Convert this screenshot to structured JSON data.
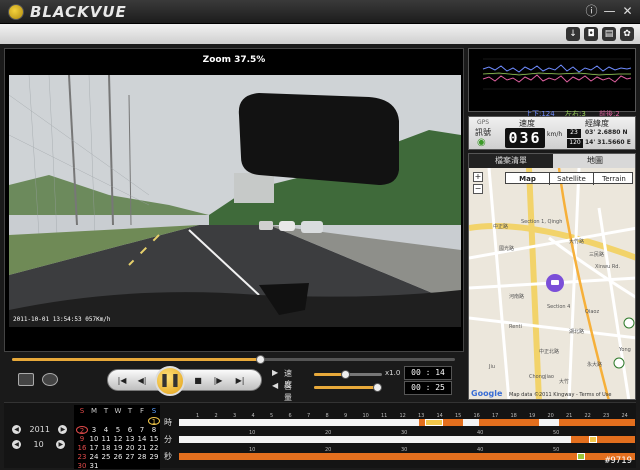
{
  "app": {
    "logo_text": "BLACKVUE"
  },
  "video": {
    "zoom_label": "Zoom 37.5%",
    "stamp": "2011-10-01 13:54:53 057Km/h"
  },
  "transport": {
    "speed_label": "速度",
    "speed_value": "x1.0",
    "volume_label": "音量",
    "current_time": "00 : 14",
    "total_time": "00 : 25",
    "seek_fraction": 0.56,
    "speed_fraction": 0.45,
    "volume_fraction": 0.92
  },
  "graph": {
    "up_down": "上下:124",
    "left_right": "左右:3",
    "front_back": "前後:2"
  },
  "gps": {
    "gps_label": "GPS",
    "signal_label": "訊號",
    "speed_title": "速度",
    "speed_value": "036",
    "speed_unit": "km/h",
    "coord_title": "經緯度",
    "lat_deg": "23",
    "lat_rest": "03' 2.6880 N",
    "lon_deg": "120",
    "lon_rest": "14' 31.5660 E"
  },
  "map": {
    "tab_file_list": "檔案清單",
    "tab_map": "地圖",
    "type_map": "Map",
    "type_satellite": "Satellite",
    "type_terrain": "Terrain",
    "copyright": "Map data ©2011 Kingway - Terms of Use",
    "google": "Google",
    "labels": [
      "Section 1, Qingh",
      "國光路",
      "Xinwu Rd.",
      "三民路",
      "河南路",
      "Section 4",
      "中正北路",
      "永大路",
      "Yong",
      "大竹路",
      "Qiaoz",
      "大竹",
      "Renti",
      "Jiu",
      "中正路",
      "湖北路",
      "Chongjiao"
    ]
  },
  "date": {
    "year": "2011",
    "month": "10"
  },
  "calendar": {
    "headers": [
      "S",
      "M",
      "T",
      "W",
      "T",
      "F",
      "S"
    ],
    "weeks": [
      [
        "",
        "",
        "",
        "",
        "",
        "",
        "1"
      ],
      [
        "2",
        "3",
        "4",
        "5",
        "6",
        "7",
        "8"
      ],
      [
        "9",
        "10",
        "11",
        "12",
        "13",
        "14",
        "15"
      ],
      [
        "16",
        "17",
        "18",
        "19",
        "20",
        "21",
        "22"
      ],
      [
        "23",
        "24",
        "25",
        "26",
        "27",
        "28",
        "29"
      ],
      [
        "30",
        "31",
        "",
        "",
        "",
        "",
        ""
      ]
    ],
    "selected_day": "1",
    "circled_day": "2"
  },
  "timeline": {
    "hour_label": "時",
    "minute_label": "分",
    "second_label": "秒",
    "hour_ticks": [
      "1",
      "2",
      "3",
      "4",
      "5",
      "6",
      "7",
      "8",
      "9",
      "10",
      "11",
      "12",
      "13",
      "14",
      "15",
      "16",
      "17",
      "18",
      "19",
      "20",
      "21",
      "22",
      "23",
      "24"
    ],
    "minute_ticks": [
      "10",
      "20",
      "30",
      "40",
      "50"
    ],
    "second_ticks": [
      "10",
      "20",
      "30",
      "40",
      "50"
    ],
    "colors": {
      "recorded": "#e36f1e",
      "highlight": "#f2c74a",
      "green": "#9bc63a"
    }
  },
  "watermark": "#9719"
}
